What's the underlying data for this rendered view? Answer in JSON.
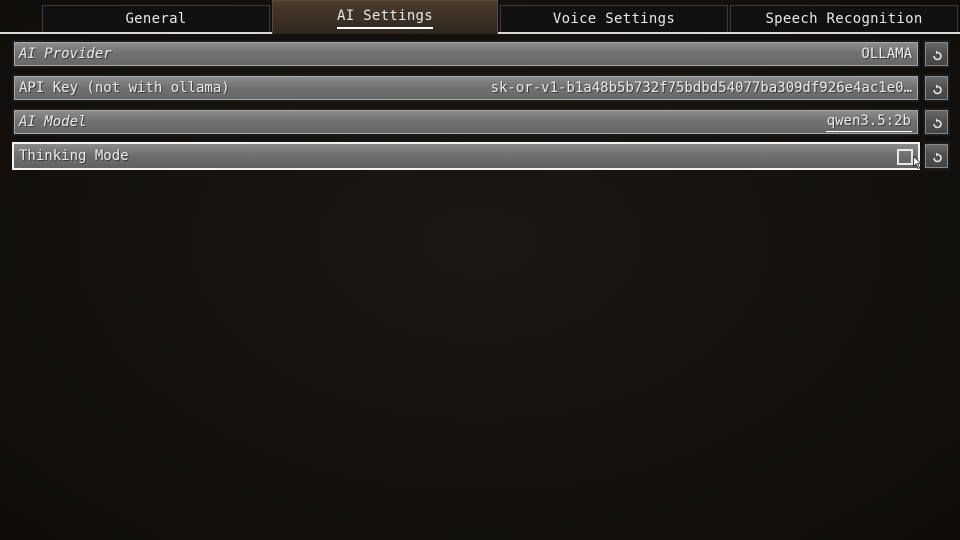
{
  "tabs": [
    {
      "label": "General",
      "active": false
    },
    {
      "label": "AI Settings",
      "active": true
    },
    {
      "label": "Voice Settings",
      "active": false
    },
    {
      "label": "Speech Recognition",
      "active": false
    }
  ],
  "settings": {
    "ai_provider": {
      "label": "AI Provider",
      "value": "OLLAMA"
    },
    "api_key": {
      "label": "API Key (not with ollama)",
      "value": "sk-or-v1-b1a48b5b732f75bdbd54077ba309df926e4ac1e0…"
    },
    "ai_model": {
      "label": "AI Model",
      "value": "qwen3.5:2b"
    },
    "thinking_mode": {
      "label": "Thinking Mode",
      "checked": false
    }
  },
  "reset_icon": "reset-arrow-icon",
  "colors": {
    "background": "#120f0c",
    "row_fill": "#727272",
    "active_tab": "#3b2f23",
    "text": "#ececec"
  }
}
